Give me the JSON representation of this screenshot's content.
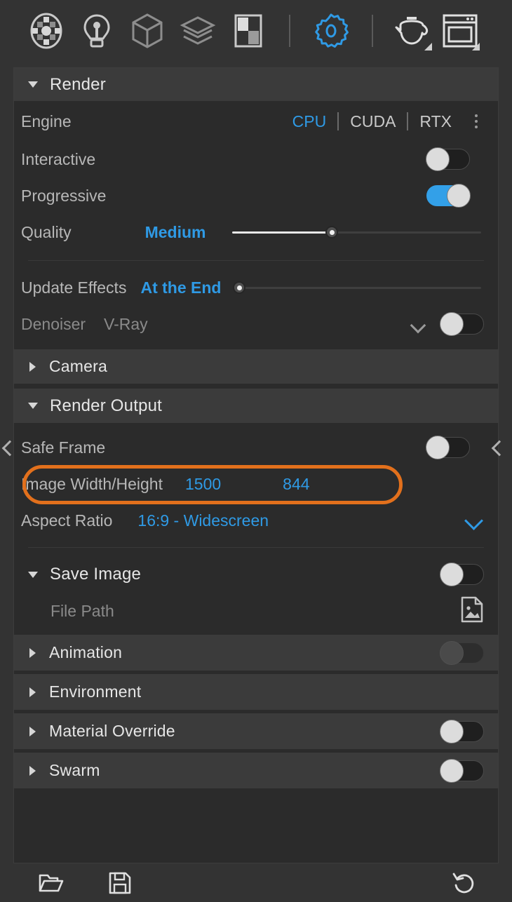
{
  "toolbar": {
    "icons": [
      {
        "name": "material-preview-icon",
        "label": "Material Preview"
      },
      {
        "name": "light-bulb-icon",
        "label": "Lights"
      },
      {
        "name": "geometry-cube-icon",
        "label": "Geometry"
      },
      {
        "name": "layers-icon",
        "label": "Layers"
      },
      {
        "name": "texture-checker-icon",
        "label": "Textures"
      },
      {
        "name": "settings-gear-icon",
        "label": "Settings"
      },
      {
        "name": "teapot-render-icon",
        "label": "Render"
      },
      {
        "name": "render-frame-icon",
        "label": "Render Frame Window"
      }
    ]
  },
  "render": {
    "title": "Render",
    "engine": {
      "label": "Engine",
      "options": [
        "CPU",
        "CUDA",
        "RTX"
      ],
      "selected": "CPU"
    },
    "interactive": {
      "label": "Interactive",
      "value": "off"
    },
    "progressive": {
      "label": "Progressive",
      "value": "on"
    },
    "quality": {
      "label": "Quality",
      "value": "Medium",
      "slider_percent": 40
    },
    "update_effects": {
      "label": "Update Effects",
      "value": "At the End",
      "slider_percent": 0
    },
    "denoiser": {
      "label": "Denoiser",
      "value": "V-Ray",
      "toggle": "off"
    }
  },
  "camera": {
    "title": "Camera"
  },
  "render_output": {
    "title": "Render Output",
    "safe_frame": {
      "label": "Safe Frame",
      "value": "off"
    },
    "image_size": {
      "label": "Image Width/Height",
      "width": "1500",
      "height": "844"
    },
    "aspect_ratio": {
      "label": "Aspect Ratio",
      "value": "16:9 - Widescreen"
    },
    "save_image": {
      "title": "Save Image",
      "value": "off"
    },
    "file_path": {
      "label": "File Path",
      "placeholder": "File Path"
    }
  },
  "sections": {
    "animation": {
      "title": "Animation",
      "toggle": "off-disabled"
    },
    "environment": {
      "title": "Environment"
    },
    "material_override": {
      "title": "Material Override",
      "toggle": "off"
    },
    "swarm": {
      "title": "Swarm",
      "toggle": "off"
    }
  },
  "footer": {
    "open_label": "Open",
    "save_label": "Save",
    "reset_label": "Reset"
  },
  "colors": {
    "accent_blue": "#2f9ae5",
    "toggle_on": "#33a0e8",
    "highlight_orange": "#e2701c",
    "panel_bg": "#2b2b2b",
    "section_bg": "#3b3b3b"
  }
}
